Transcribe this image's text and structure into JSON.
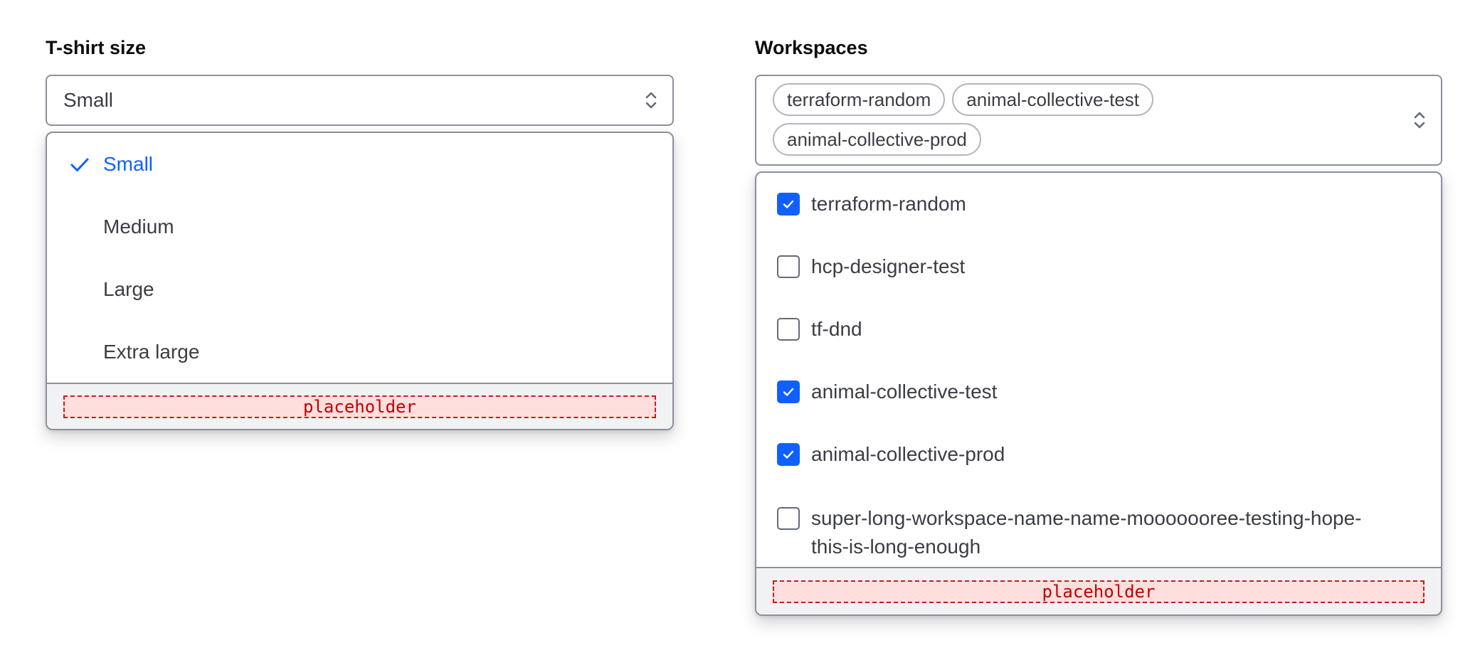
{
  "tshirt": {
    "label": "T-shirt size",
    "value": "Small",
    "options": [
      {
        "label": "Small",
        "selected": true
      },
      {
        "label": "Medium",
        "selected": false
      },
      {
        "label": "Large",
        "selected": false
      },
      {
        "label": "Extra large",
        "selected": false
      }
    ],
    "footer_placeholder": "placeholder"
  },
  "workspaces": {
    "label": "Workspaces",
    "tags": [
      "terraform-random",
      "animal-collective-test",
      "animal-collective-prod"
    ],
    "options": [
      {
        "label": "terraform-random",
        "checked": true
      },
      {
        "label": "hcp-designer-test",
        "checked": false
      },
      {
        "label": "tf-dnd",
        "checked": false
      },
      {
        "label": "animal-collective-test",
        "checked": true
      },
      {
        "label": "animal-collective-prod",
        "checked": true
      },
      {
        "label": "super-long-workspace-name-name-mooooooree-testing-hope-this-is-long-enough",
        "checked": false
      }
    ],
    "footer_placeholder": "placeholder"
  },
  "colors": {
    "accent": "#1060ff",
    "border": "#8c909c",
    "text": "#3b3d45",
    "placeholder_red": "#cc1a1a"
  },
  "icons": {
    "select_chevron": "chevron-up-down-icon",
    "selected_check": "check-icon",
    "checkbox_check": "checkbox-check-icon"
  }
}
